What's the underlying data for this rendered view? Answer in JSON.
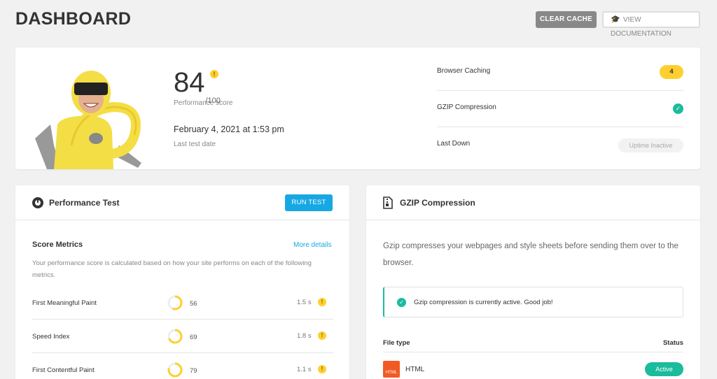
{
  "header": {
    "title": "DASHBOARD",
    "clear_cache_label": "CLEAR CACHE",
    "view_docs_label": "VIEW DOCUMENTATION"
  },
  "summary": {
    "score": "84",
    "score_max": "/100",
    "score_warn": "!",
    "score_label": "Performance score",
    "test_date": "February 4, 2021 at 1:53 pm",
    "test_date_label": "Last test date",
    "rows": [
      {
        "label": "Browser Caching",
        "value": "4"
      },
      {
        "label": "GZIP Compression",
        "value": "✓"
      },
      {
        "label": "Last Down",
        "value": "Uptime Inactive"
      }
    ]
  },
  "performance": {
    "title": "Performance Test",
    "run_label": "RUN TEST",
    "score_metrics_title": "Score Metrics",
    "more_details": "More details",
    "description": "Your performance score is calculated based on how your site performs on each of the following metrics.",
    "metrics": [
      {
        "name": "First Meaningful Paint",
        "score": "56",
        "score_value": 56,
        "time": "1.5 s",
        "warn": "!"
      },
      {
        "name": "Speed Index",
        "score": "69",
        "score_value": 69,
        "time": "1.8 s",
        "warn": "!"
      },
      {
        "name": "First Contentful Paint",
        "score": "79",
        "score_value": 79,
        "time": "1.1 s",
        "warn": "!"
      }
    ]
  },
  "gzip": {
    "title": "GZIP Compression",
    "description": "Gzip compresses your webpages and style sheets before sending them over to the browser.",
    "notice": "Gzip compression is currently active. Good job!",
    "col_type": "File type",
    "col_status": "Status",
    "files": [
      {
        "type": "HTML",
        "icon_text": "HTML",
        "status": "Active"
      }
    ]
  },
  "colors": {
    "accent_blue": "#17a8e3",
    "warning_yellow": "#fecf2f",
    "success_green": "#1abc9c",
    "html_orange": "#f15a24"
  }
}
